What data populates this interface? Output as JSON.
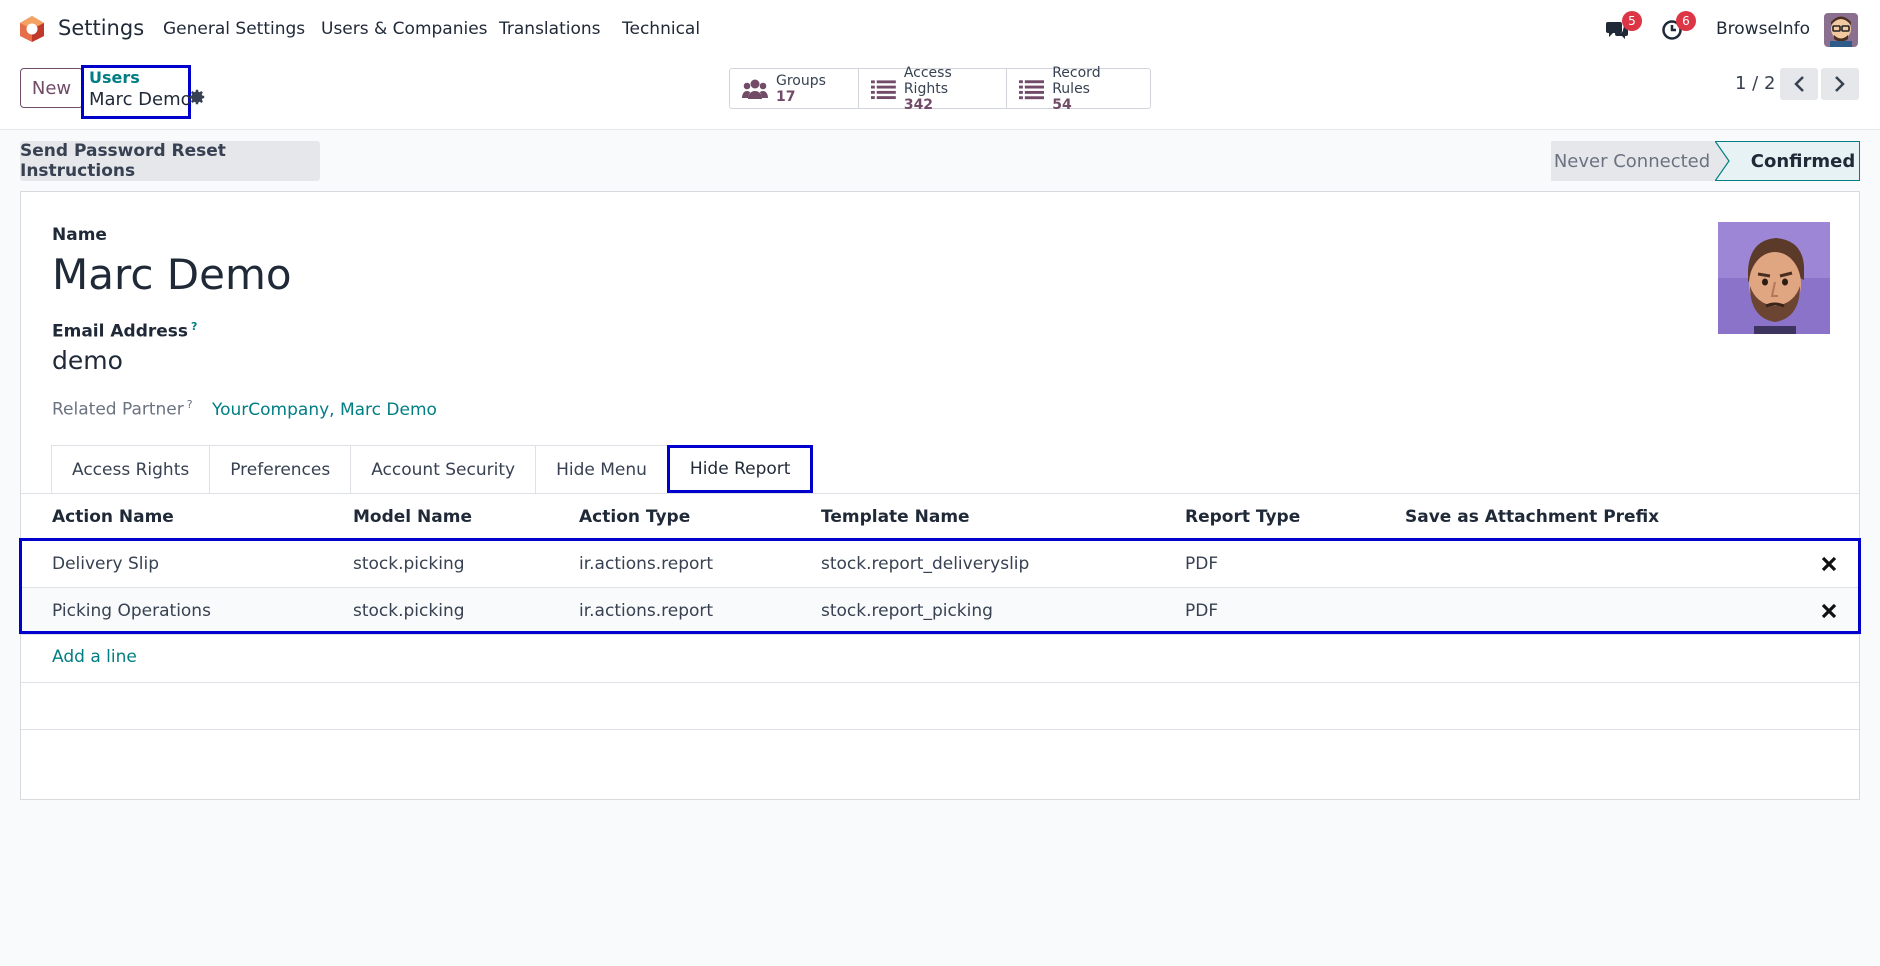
{
  "navbar": {
    "app_name": "Settings",
    "menu": [
      "General Settings",
      "Users & Companies",
      "Translations",
      "Technical"
    ],
    "messages_badge": "5",
    "activities_badge": "6",
    "user_name": "BrowseInfo"
  },
  "control_panel": {
    "new_label": "New",
    "breadcrumb_parent": "Users",
    "breadcrumb_current": "Marc Demo",
    "smart_buttons": [
      {
        "label": "Groups",
        "value": "17",
        "icon": "users-icon"
      },
      {
        "label": "Access Rights",
        "value": "342",
        "icon": "list-icon"
      },
      {
        "label": "Record Rules",
        "value": "54",
        "icon": "list-icon"
      }
    ],
    "pager": "1 / 2"
  },
  "status": {
    "reset_button": "Send Password Reset Instructions",
    "states": [
      "Never Connected",
      "Confirmed"
    ],
    "active_state": "Confirmed"
  },
  "form": {
    "name_label": "Name",
    "name_value": "Marc Demo",
    "email_label": "Email Address",
    "email_help": "?",
    "email_value": "demo",
    "partner_label": "Related Partner",
    "partner_help": "?",
    "partner_value": "YourCompany, Marc Demo"
  },
  "tabs": [
    "Access Rights",
    "Preferences",
    "Account Security",
    "Hide Menu",
    "Hide Report"
  ],
  "active_tab": "Hide Report",
  "table": {
    "headers": [
      "Action Name",
      "Model Name",
      "Action Type",
      "Template Name",
      "Report Type",
      "Save as Attachment Prefix"
    ],
    "rows": [
      [
        "Delivery Slip",
        "stock.picking",
        "ir.actions.report",
        "stock.report_deliveryslip",
        "PDF",
        ""
      ],
      [
        "Picking Operations",
        "stock.picking",
        "ir.actions.report",
        "stock.report_picking",
        "PDF",
        ""
      ]
    ],
    "add_line": "Add a line"
  },
  "colors": {
    "brand": "#714b67",
    "link": "#017e84",
    "highlight": "#0000cc",
    "badge": "#dc3545"
  }
}
